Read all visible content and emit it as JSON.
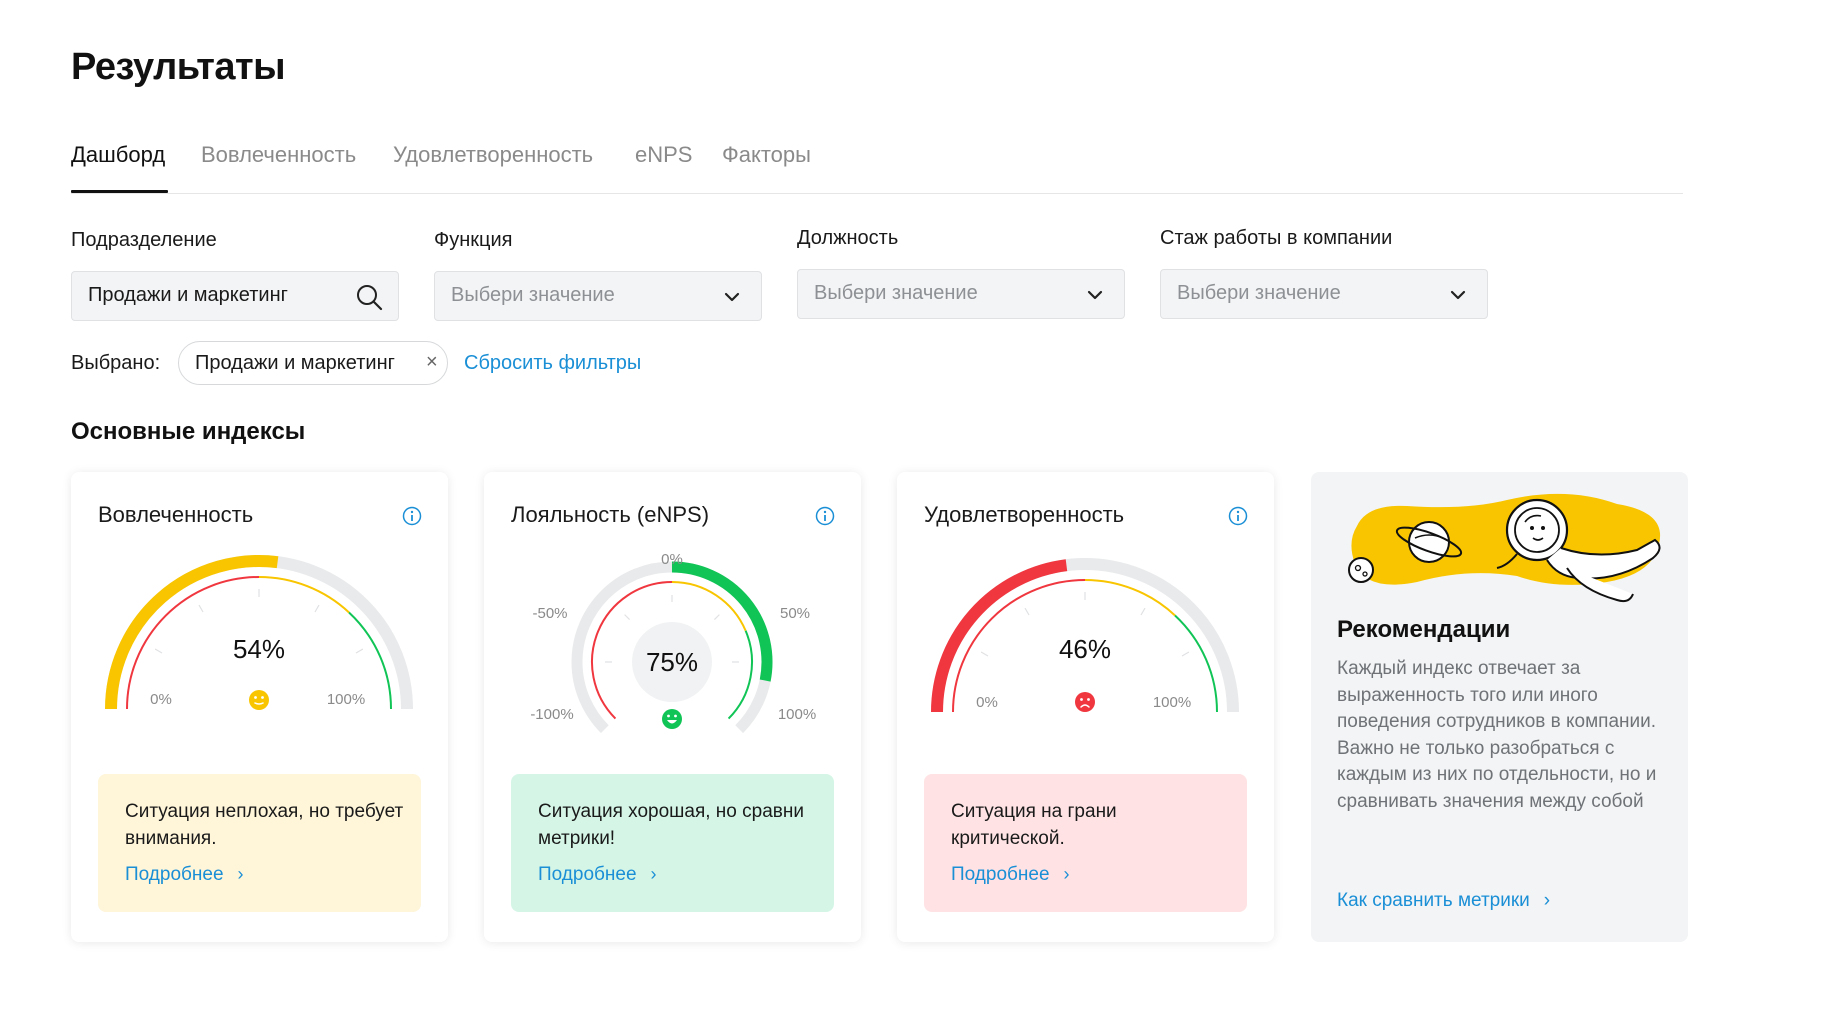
{
  "page": {
    "title": "Результаты"
  },
  "tabs": [
    {
      "label": "Дашборд",
      "active": true
    },
    {
      "label": "Вовлеченность",
      "active": false
    },
    {
      "label": "Удовлетворенность",
      "active": false
    },
    {
      "label": "eNPS",
      "active": false
    },
    {
      "label": "Факторы",
      "active": false
    }
  ],
  "filters": {
    "division": {
      "label": "Подразделение",
      "value": "Продажи и маркетинг",
      "icon": "search-icon"
    },
    "function": {
      "label": "Функция",
      "placeholder": "Выбери значение",
      "icon": "chevron-down-icon"
    },
    "position": {
      "label": "Должность",
      "placeholder": "Выбери значение",
      "icon": "chevron-down-icon"
    },
    "tenure": {
      "label": "Стаж работы в компании",
      "placeholder": "Выбери значение",
      "icon": "chevron-down-icon"
    }
  },
  "selected": {
    "label": "Выбрано:",
    "chip": "Продажи и маркетинг",
    "chip_close": "×",
    "reset_label": "Сбросить фильтры"
  },
  "section": {
    "title": "Основные индексы"
  },
  "colors": {
    "red": "#f0373f",
    "yellow": "#f8c500",
    "green": "#10c456",
    "track": "#e9eaeb",
    "link": "#1a8fd6"
  },
  "cards": {
    "engagement": {
      "title": "Вовлеченность",
      "value": 54,
      "value_label": "54%",
      "min_label": "0%",
      "max_label": "100%",
      "mood": "neutral-face-icon",
      "status_text": "Ситуация неплохая, но требует внимания.",
      "status_color": "#fff5d9",
      "link_label": "Подробнее"
    },
    "enps": {
      "title": "Лояльность (eNPS)",
      "value": 75,
      "value_label": "75%",
      "ticks": [
        "-100%",
        "-50%",
        "0%",
        "50%",
        "100%"
      ],
      "mood": "happy-face-icon",
      "status_text": "Ситуация хорошая, но сравни метрики!",
      "status_color": "#d5f6e7",
      "link_label": "Подробнее"
    },
    "satisfaction": {
      "title": "Удовлетворенность",
      "value": 46,
      "value_label": "46%",
      "min_label": "0%",
      "max_label": "100%",
      "mood": "sad-face-icon",
      "status_text": "Ситуация на грани критической.",
      "status_color": "#ffe3e4",
      "link_label": "Подробнее"
    }
  },
  "recommendations": {
    "title": "Рекомендации",
    "text": "Каждый индекс отвечает за выраженность того или иного поведения сотрудников в компании. Важно не только разобраться с каждым из них по отдельности, но и сравнивать значения между собой",
    "link_label": "Как сравнить метрики",
    "illustration": "astronaut-illustration"
  }
}
